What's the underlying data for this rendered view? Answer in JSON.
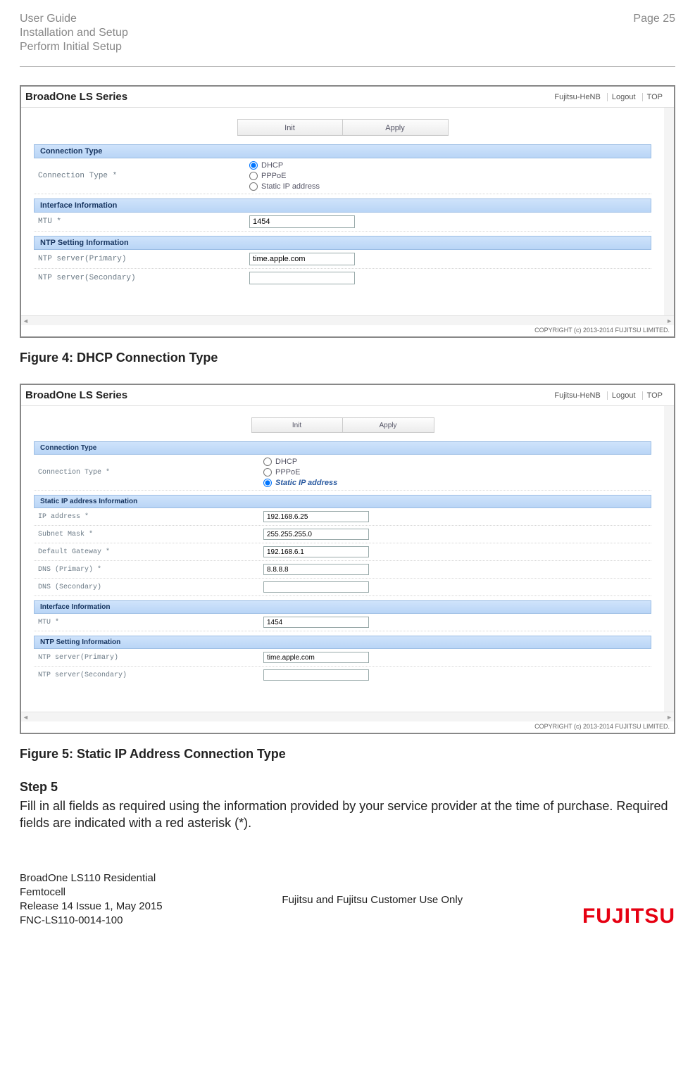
{
  "header": {
    "guide": "User Guide",
    "section": "Installation and Setup",
    "sub": "Perform Initial Setup",
    "page": "Page 25"
  },
  "shot1": {
    "brand": "BroadOne LS Series",
    "user": "Fujitsu-HeNB",
    "logout": "Logout",
    "top": "TOP",
    "tabs": {
      "init": "Init",
      "apply": "Apply"
    },
    "conn_section": "Connection Type",
    "conn_label": "Connection Type *",
    "conn_opts": {
      "dhcp": "DHCP",
      "pppoe": "PPPoE",
      "static": "Static IP address"
    },
    "iface_section": "Interface Information",
    "mtu_label": "MTU *",
    "mtu_value": "1454",
    "ntp_section": "NTP Setting Information",
    "ntp1_label": "NTP server(Primary)",
    "ntp1_value": "time.apple.com",
    "ntp2_label": "NTP server(Secondary)",
    "ntp2_value": "",
    "copyright": "COPYRIGHT (c) 2013-2014 FUJITSU LIMITED."
  },
  "fig4": "Figure 4: DHCP Connection Type",
  "shot2": {
    "brand": "BroadOne LS Series",
    "user": "Fujitsu-HeNB",
    "logout": "Logout",
    "top": "TOP",
    "tabs": {
      "init": "Init",
      "apply": "Apply"
    },
    "conn_section": "Connection Type",
    "conn_label": "Connection Type *",
    "conn_opts": {
      "dhcp": "DHCP",
      "pppoe": "PPPoE",
      "static": "Static IP address"
    },
    "static_section": "Static IP address Information",
    "ip_label": "IP address *",
    "ip_value": "192.168.6.25",
    "mask_label": "Subnet Mask *",
    "mask_value": "255.255.255.0",
    "gw_label": "Default Gateway *",
    "gw_value": "192.168.6.1",
    "dns1_label": "DNS (Primary) *",
    "dns1_value": "8.8.8.8",
    "dns2_label": "DNS (Secondary)",
    "dns2_value": "",
    "iface_section": "Interface Information",
    "mtu_label": "MTU *",
    "mtu_value": "1454",
    "ntp_section": "NTP Setting Information",
    "ntp1_label": "NTP server(Primary)",
    "ntp1_value": "time.apple.com",
    "ntp2_label": "NTP server(Secondary)",
    "ntp2_value": "",
    "copyright": "COPYRIGHT (c) 2013-2014 FUJITSU LIMITED."
  },
  "fig5": "Figure 5: Static IP Address Connection Type",
  "step": {
    "h": "Step 5",
    "p": "Fill in all fields as required using the information provided by your service provider at the time of purchase. Required fields are indicated with a red asterisk (*)."
  },
  "footer": {
    "l1": "BroadOne LS110 Residential",
    "l2": "Femtocell",
    "l3": "Release 14 Issue 1, May 2015",
    "l4": "FNC-LS110-0014-100",
    "mid": "Fujitsu and Fujitsu Customer Use Only",
    "logo": "FUJITSU"
  }
}
